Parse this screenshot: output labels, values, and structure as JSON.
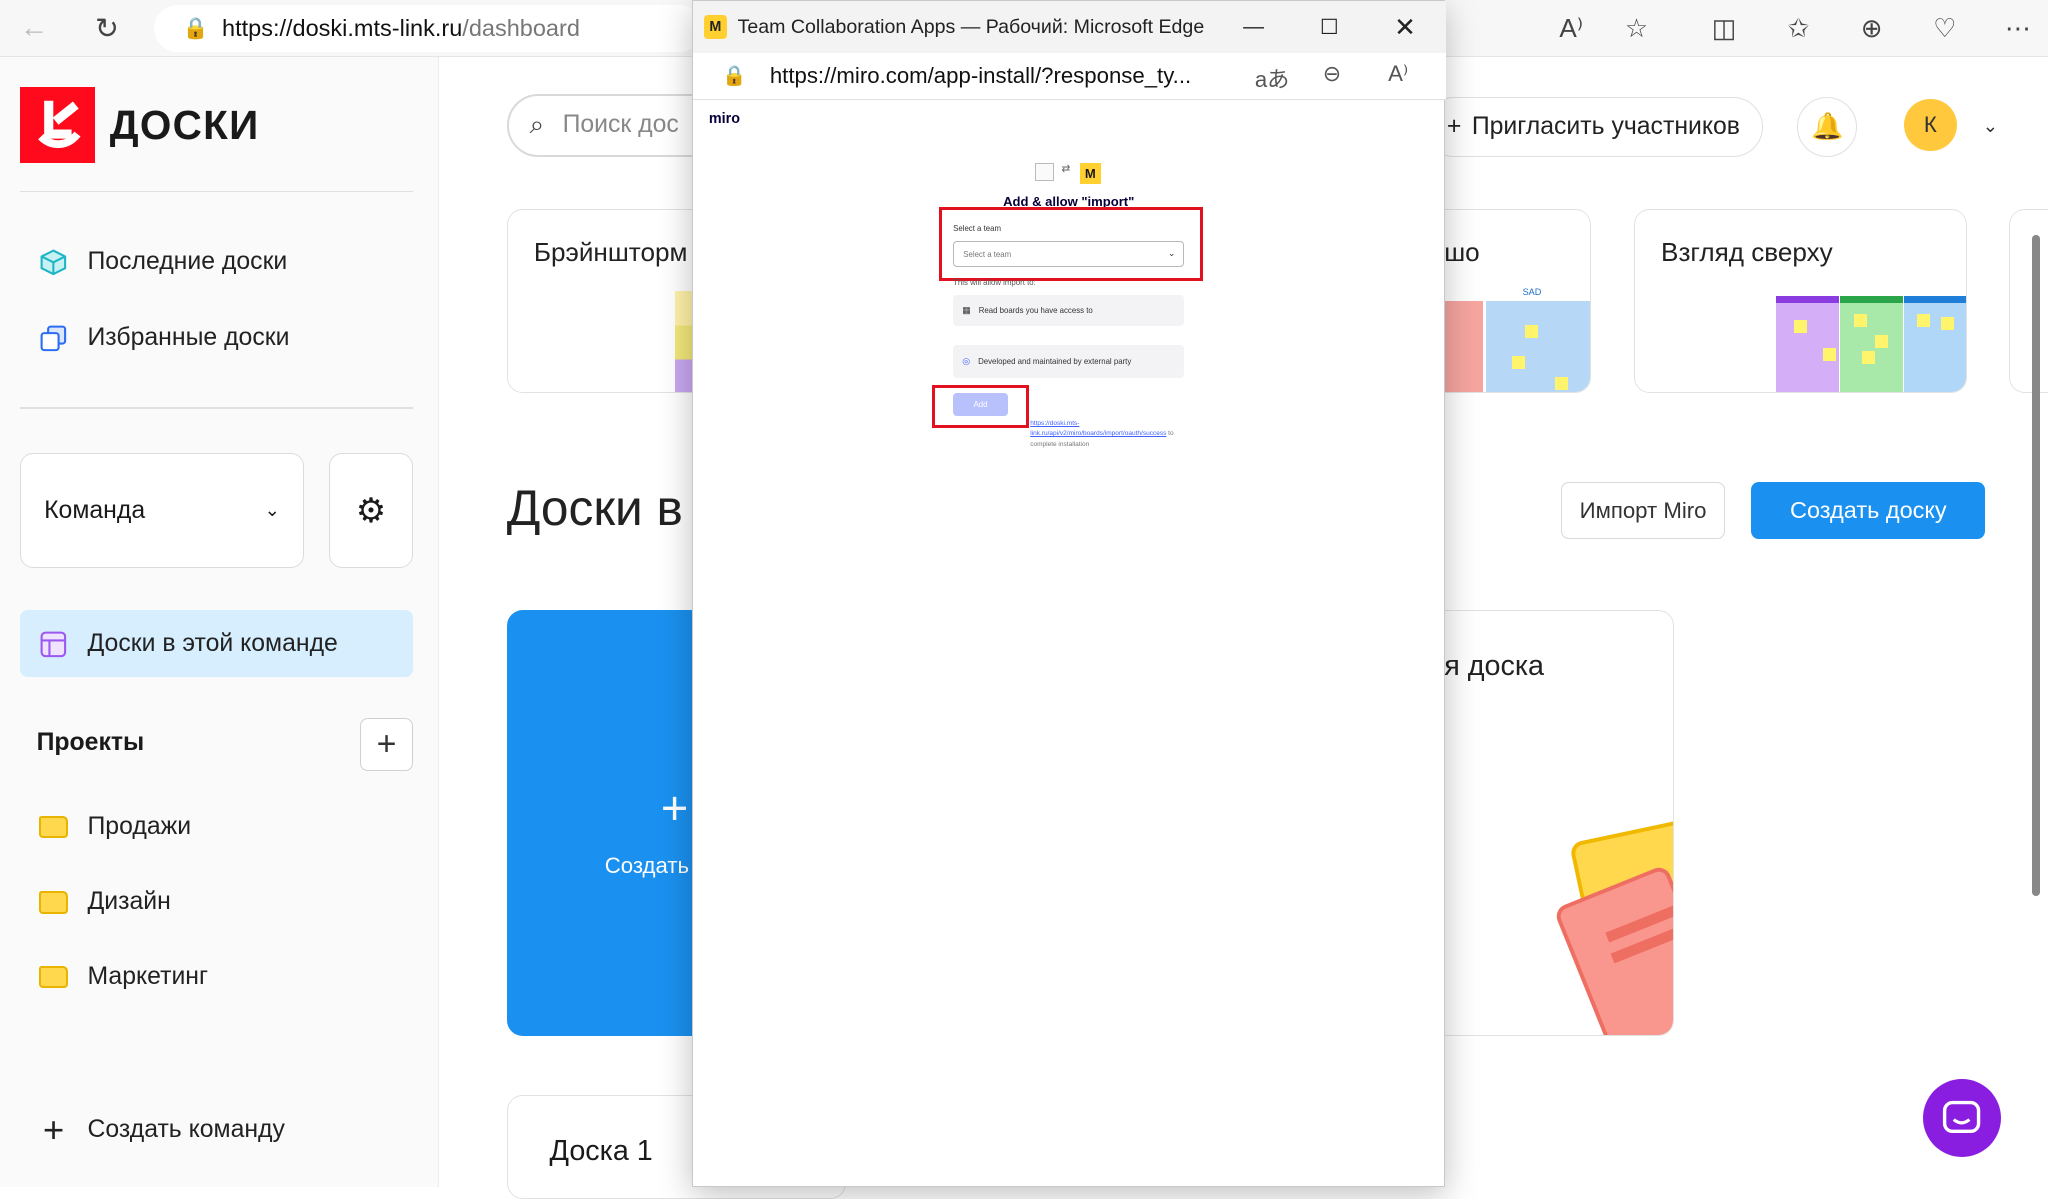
{
  "browser": {
    "url_host": "https://doski.mts-link.ru",
    "url_path": "/dashboard"
  },
  "sidebar": {
    "logo_text": "ДОСКИ",
    "nav": [
      {
        "label": "Последние доски",
        "icon": "cube-icon"
      },
      {
        "label": "Избранные доски",
        "icon": "copy-boards-icon"
      }
    ],
    "team_select": "Команда",
    "active_item": "Доски в этой команде",
    "projects_title": "Проекты",
    "projects": [
      "Продажи",
      "Дизайн",
      "Маркетинг"
    ],
    "create_team": "Создать команду"
  },
  "header": {
    "search_placeholder": "Поиск дос",
    "invite": "Пригласить участников",
    "avatar_initial": "К"
  },
  "templates": [
    {
      "title": "Брэйншторм"
    },
    {
      "title": "шо",
      "sticker_label": "SAD"
    },
    {
      "title": "Взгляд сверху"
    }
  ],
  "main": {
    "section_title": "Доски в",
    "import_button": "Импорт Miro",
    "create_button": "Создать доску",
    "create_card_label": "Создать",
    "board_card_title": "я доска",
    "board1_title": "Доска 1"
  },
  "popup": {
    "window_title": "Team Collaboration Apps — Рабочий: Microsoft Edge",
    "url": "https://miro.com/app-install/?response_ty...",
    "brand": "miro",
    "install_title": "Add & allow \"import\"",
    "select_label": "Select a team",
    "select_placeholder": "Select a team",
    "allow_label": "This will allow import to:",
    "perm_read": "Read boards you have access to",
    "perm_external": "Developed and maintained by external party",
    "add_button": "Add",
    "footer_link": "https://doski.mts-link.ru/api/v2/miro/boards/import/oauth/success",
    "footer_text": " to complete installation"
  }
}
